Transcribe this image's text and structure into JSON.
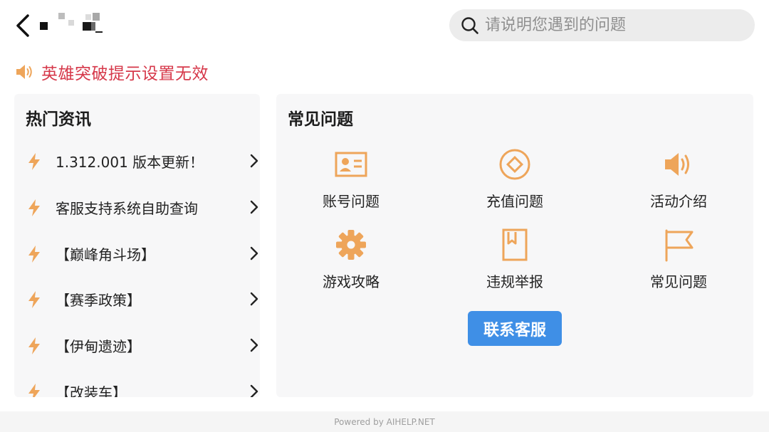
{
  "header": {
    "back_icon": "chevron-left-icon",
    "title_obscured": true
  },
  "search": {
    "icon": "search-icon",
    "placeholder": "请说明您遇到的问题",
    "value": ""
  },
  "notice": {
    "icon": "speaker-icon",
    "text": "英雄突破提示设置无效",
    "color": "#d6384a"
  },
  "hot_news": {
    "title": "热门资讯",
    "item_icon": "lightning-icon",
    "items": [
      {
        "label": "1.312.001 版本更新！"
      },
      {
        "label": "客服支持系统自助查询"
      },
      {
        "label": "【巅峰角斗场】"
      },
      {
        "label": "【赛季政策】"
      },
      {
        "label": "【伊甸遗迹】"
      },
      {
        "label": "【改装车】"
      }
    ]
  },
  "faq": {
    "title": "常见问题",
    "accent_color": "#eea55a",
    "categories": [
      {
        "label": "账号问题",
        "icon": "id-card-icon"
      },
      {
        "label": "充值问题",
        "icon": "coin-icon"
      },
      {
        "label": "活动介绍",
        "icon": "speaker-icon"
      },
      {
        "label": "游戏攻略",
        "icon": "gear-icon"
      },
      {
        "label": "违规举报",
        "icon": "report-book-icon"
      },
      {
        "label": "常见问题",
        "icon": "flag-icon"
      }
    ],
    "contact_button": "联系客服",
    "button_color": "#3f8fe6"
  },
  "footer": {
    "text": "Powered by AIHELP.NET"
  }
}
